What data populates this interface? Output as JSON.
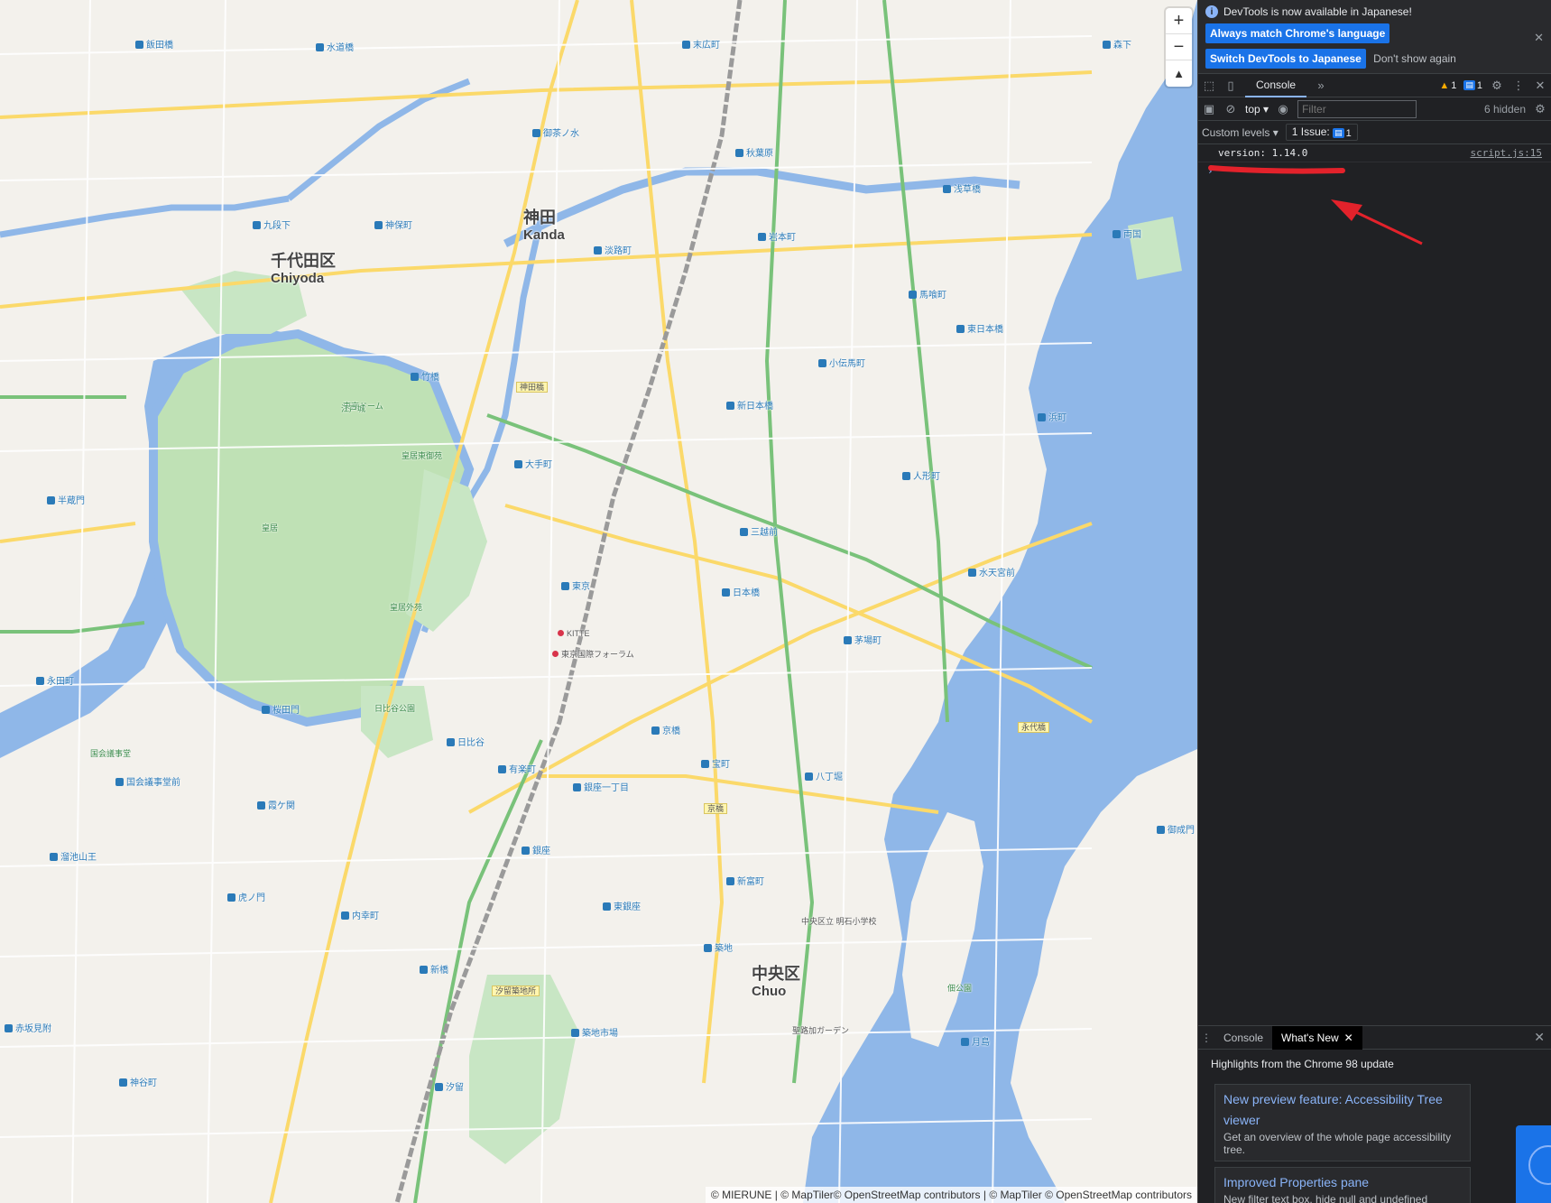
{
  "map": {
    "districts": [
      {
        "ja": "千代田区",
        "en": "Chiyoda"
      },
      {
        "ja": "神田",
        "en": "Kanda"
      },
      {
        "ja": "中央区",
        "en": "Chuo"
      }
    ],
    "stations": [
      "水道橋",
      "飯田橋",
      "九段下",
      "神保町",
      "御茶ノ水",
      "秋葉原",
      "岩本町",
      "浅草橋",
      "淡路町",
      "竹橋",
      "大手町",
      "東京",
      "有楽町",
      "日比谷",
      "銀座",
      "新橋",
      "築地",
      "八丁堀",
      "茅場町",
      "人形町",
      "水天宮前",
      "馬喰町",
      "東日本橋",
      "三越前",
      "日本橋",
      "宝町",
      "京橋",
      "霞ケ関",
      "桜田門",
      "虎ノ門",
      "内幸町",
      "汐留",
      "月島",
      "新日本橋",
      "小伝馬町",
      "浜町",
      "両国",
      "半蔵門",
      "永田町",
      "国会議事堂前",
      "溜池山王",
      "新富町",
      "東銀座",
      "銀座一丁目",
      "築地市場",
      "御成門",
      "神谷町",
      "赤坂見附",
      "末広町",
      "森下"
    ],
    "poi": [
      "東京ドーム",
      "皇居東御苑",
      "江戸城",
      "皇居外苑",
      "日比谷公園",
      "皇居",
      "国会議事堂",
      "KITTE",
      "東京国際フォーラム",
      "中央区立 明石小学校",
      "佃公園",
      "聖路加ガーデン"
    ],
    "roads": [
      "神田橋",
      "京橋",
      "汐留築地所",
      "永代橋"
    ],
    "zoom_in_label": "+",
    "zoom_out_label": "−",
    "compass_label": "▲",
    "attribution": "© MIERUNE | © MapTiler© OpenStreetMap contributors | © MapTiler © OpenStreetMap contributors"
  },
  "devtools": {
    "infobar": {
      "message": "DevTools is now available in Japanese!",
      "button_match": "Always match Chrome's language",
      "button_switch": "Switch DevTools to Japanese",
      "button_dismiss": "Don't show again"
    },
    "toolbar": {
      "tab_console": "Console",
      "more_tabs": "»",
      "warnings_count": "1",
      "info_count": "1"
    },
    "console_toolbar": {
      "context": "top",
      "filter_placeholder": "Filter",
      "hidden_count": "6 hidden",
      "levels": "Custom levels",
      "issues": "1 Issue:",
      "issues_count": "1"
    },
    "log": [
      {
        "message": "version: 1.14.0",
        "source": "script.js:15"
      }
    ],
    "prompt": "›",
    "drawer": {
      "tab_console": "Console",
      "tab_whats_new": "What's New",
      "headline": "Highlights from the Chrome 98 update",
      "cards": [
        {
          "title": "New preview feature: Accessibility Tree viewer",
          "desc": "Get an overview of the whole page accessibility tree."
        },
        {
          "title": "Improved Properties pane",
          "desc": "New filter text box, hide null and undefined"
        }
      ]
    }
  },
  "colors": {
    "water": "#8fb7e8",
    "park": "#c8e6c4",
    "major_road": "#fbd96a",
    "arterial_road": "#79c27a",
    "accent": "#1a73e8",
    "annotation": "#e3222b"
  }
}
